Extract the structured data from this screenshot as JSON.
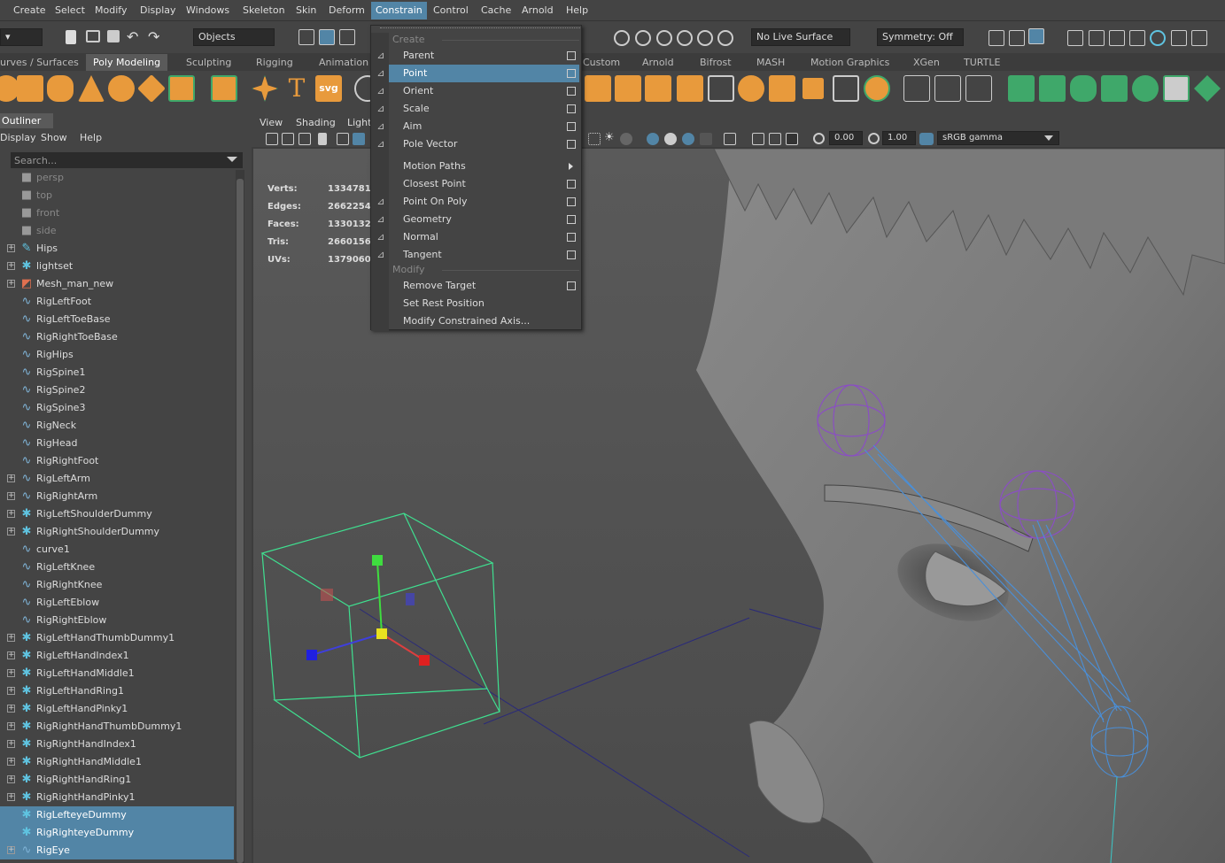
{
  "menubar": {
    "items": [
      "Create",
      "Select",
      "Modify",
      "Display",
      "Windows",
      "Skeleton",
      "Skin",
      "Deform",
      "Constrain",
      "Control",
      "Cache",
      "Arnold",
      "Help"
    ],
    "active": "Constrain"
  },
  "statusline": {
    "objects": "Objects",
    "live_surface": "No Live Surface",
    "symmetry": "Symmetry: Off"
  },
  "shelf_tabs": {
    "items": [
      "urves / Surfaces",
      "Poly Modeling",
      "Sculpting",
      "Rigging",
      "Animation",
      "Custom",
      "Arnold",
      "Bifrost",
      "MASH",
      "Motion Graphics",
      "XGen",
      "TURTLE"
    ],
    "active": "Poly Modeling"
  },
  "shelf": {
    "text_tool": "T",
    "svg_tool": "svg"
  },
  "outliner": {
    "title": "Outliner",
    "menus": [
      "Display",
      "Show",
      "Help"
    ],
    "search_placeholder": "Search...",
    "items": [
      {
        "label": "persp",
        "type": "camera"
      },
      {
        "label": "top",
        "type": "camera"
      },
      {
        "label": "front",
        "type": "camera"
      },
      {
        "label": "side",
        "type": "camera"
      },
      {
        "label": "Hips",
        "type": "joint",
        "expandable": true
      },
      {
        "label": "lightset",
        "type": "set",
        "expandable": true
      },
      {
        "label": "Mesh_man_new",
        "type": "mesh",
        "expandable": true
      },
      {
        "label": "RigLeftFoot",
        "type": "curve"
      },
      {
        "label": "RigLeftToeBase",
        "type": "curve"
      },
      {
        "label": "RigRightToeBase",
        "type": "curve"
      },
      {
        "label": "RigHips",
        "type": "curve"
      },
      {
        "label": "RigSpine1",
        "type": "curve"
      },
      {
        "label": "RigSpine2",
        "type": "curve"
      },
      {
        "label": "RigSpine3",
        "type": "curve"
      },
      {
        "label": "RigNeck",
        "type": "curve"
      },
      {
        "label": "RigHead",
        "type": "curve"
      },
      {
        "label": "RigRightFoot",
        "type": "curve"
      },
      {
        "label": "RigLeftArm",
        "type": "curve",
        "expandable": true
      },
      {
        "label": "RigRightArm",
        "type": "curve",
        "expandable": true
      },
      {
        "label": "RigLeftShoulderDummy",
        "type": "set",
        "expandable": true
      },
      {
        "label": "RigRightShoulderDummy",
        "type": "set",
        "expandable": true
      },
      {
        "label": "curve1",
        "type": "curve"
      },
      {
        "label": "RigLeftKnee",
        "type": "curve"
      },
      {
        "label": "RigRightKnee",
        "type": "curve"
      },
      {
        "label": "RigLeftEblow",
        "type": "curve"
      },
      {
        "label": "RigRightEblow",
        "type": "curve"
      },
      {
        "label": "RigLeftHandThumbDummy1",
        "type": "set",
        "expandable": true
      },
      {
        "label": "RigLeftHandIndex1",
        "type": "set",
        "expandable": true
      },
      {
        "label": "RigLeftHandMiddle1",
        "type": "set",
        "expandable": true
      },
      {
        "label": "RigLeftHandRing1",
        "type": "set",
        "expandable": true
      },
      {
        "label": "RigLeftHandPinky1",
        "type": "set",
        "expandable": true
      },
      {
        "label": "RigRightHandThumbDummy1",
        "type": "set",
        "expandable": true
      },
      {
        "label": "RigRightHandIndex1",
        "type": "set",
        "expandable": true
      },
      {
        "label": "RigRightHandMiddle1",
        "type": "set",
        "expandable": true
      },
      {
        "label": "RigRightHandRing1",
        "type": "set",
        "expandable": true
      },
      {
        "label": "RigRightHandPinky1",
        "type": "set",
        "expandable": true
      },
      {
        "label": "RigLefteyeDummy",
        "type": "set",
        "selected": true
      },
      {
        "label": "RigRighteyeDummy",
        "type": "set",
        "selected": true
      },
      {
        "label": "RigEye",
        "type": "curve",
        "expandable": true,
        "selected": true
      }
    ]
  },
  "viewport": {
    "menus": [
      "View",
      "Shading",
      "Light"
    ],
    "exposure": "0.00",
    "gamma": "1.00",
    "color_space": "sRGB gamma",
    "hud": [
      {
        "label": "Verts:",
        "value": "1334781"
      },
      {
        "label": "Edges:",
        "value": "2662254"
      },
      {
        "label": "Faces:",
        "value": "1330132"
      },
      {
        "label": "Tris:",
        "value": "2660156"
      },
      {
        "label": "UVs:",
        "value": "1379060"
      }
    ]
  },
  "constrain_menu": {
    "create_header": "Create",
    "modify_header": "Modify",
    "create_items": [
      {
        "label": "Parent",
        "option_box": true
      },
      {
        "label": "Point",
        "option_box": true,
        "highlighted": true
      },
      {
        "label": "Orient",
        "option_box": true
      },
      {
        "label": "Scale",
        "option_box": true
      },
      {
        "label": "Aim",
        "option_box": true
      },
      {
        "label": "Pole Vector",
        "option_box": true
      },
      {
        "label": "Motion Paths",
        "submenu": true
      },
      {
        "label": "Closest Point",
        "option_box": true
      },
      {
        "label": "Point On Poly",
        "option_box": true
      },
      {
        "label": "Geometry",
        "option_box": true
      },
      {
        "label": "Normal",
        "option_box": true
      },
      {
        "label": "Tangent",
        "option_box": true
      }
    ],
    "modify_items": [
      {
        "label": "Remove Target",
        "option_box": true
      },
      {
        "label": "Set Rest Position"
      },
      {
        "label": "Modify Constrained Axis..."
      }
    ]
  },
  "colors": {
    "highlight": "#5285a6",
    "joint": "#5fc3e0",
    "curve": "#7fb3d6",
    "mesh": "#e07050",
    "shelf_orange": "#e89a3c",
    "shelf_green": "#3fa86a",
    "manip_green": "#3fe090"
  }
}
